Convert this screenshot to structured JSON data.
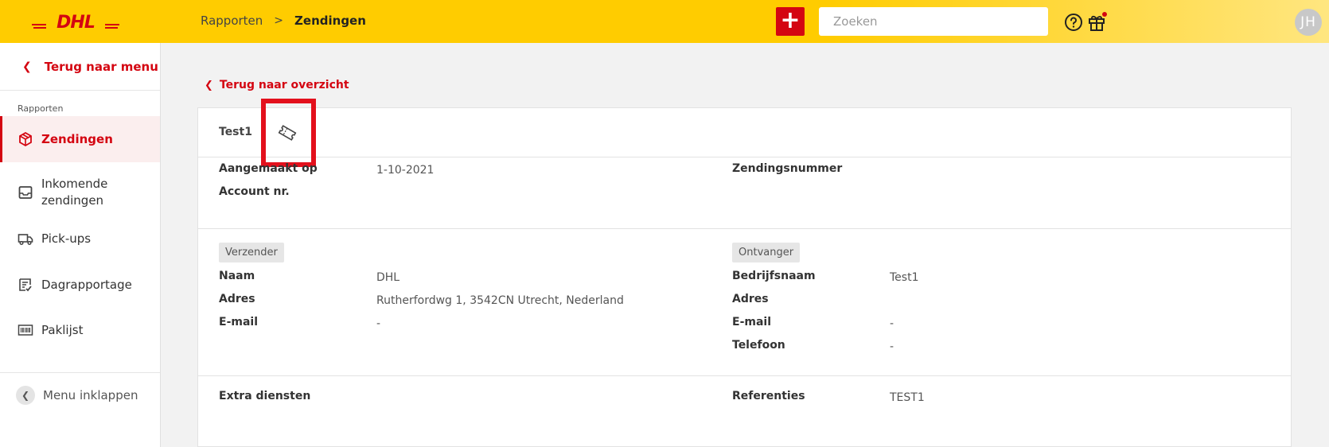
{
  "header": {
    "logo_text": "DHL",
    "breadcrumb": {
      "parent": "Rapporten",
      "separator": ">",
      "current": "Zendingen"
    },
    "add_label": "+",
    "search_placeholder": "Zoeken",
    "avatar_initials": "JH",
    "brand_color": "#ffcc00",
    "accent_color": "#d40511"
  },
  "sidebar": {
    "back_label": "Terug naar menu",
    "section_label": "Rapporten",
    "items": [
      {
        "label": "Zendingen",
        "icon": "package-icon",
        "active": true
      },
      {
        "label": "Inkomende zendingen",
        "icon": "inbox-icon",
        "active": false
      },
      {
        "label": "Pick-ups",
        "icon": "truck-icon",
        "active": false
      },
      {
        "label": "Dagrapportage",
        "icon": "checklist-icon",
        "active": false
      },
      {
        "label": "Paklijst",
        "icon": "barcode-icon",
        "active": false
      }
    ],
    "collapse_label": "Menu inklappen"
  },
  "main": {
    "back_label": "Terug naar overzicht",
    "title": "Test1",
    "meta": {
      "created_label": "Aangemaakt op",
      "created_value": "1-10-2021",
      "account_label": "Account nr.",
      "shipment_number_label": "Zendingsnummer"
    },
    "sender": {
      "tag": "Verzender",
      "name_label": "Naam",
      "name_value": "DHL",
      "address_label": "Adres",
      "address_value": "Rutherfordwg 1, 3542CN Utrecht, Nederland",
      "email_label": "E-mail",
      "email_value": "-"
    },
    "receiver": {
      "tag": "Ontvanger",
      "company_label": "Bedrijfsnaam",
      "company_value": "Test1",
      "address_label": "Adres",
      "email_label": "E-mail",
      "email_value": "-",
      "phone_label": "Telefoon",
      "phone_value": "-"
    },
    "extra_services_label": "Extra diensten",
    "references_label": "Referenties",
    "references_value": "TEST1"
  }
}
